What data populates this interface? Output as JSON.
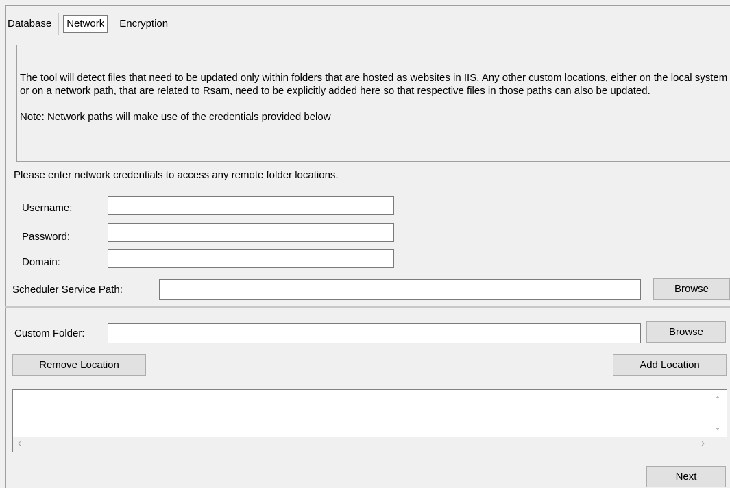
{
  "tabs": [
    {
      "label": "Database",
      "active": false
    },
    {
      "label": "Network",
      "active": true
    },
    {
      "label": "Encryption",
      "active": false
    }
  ],
  "info": {
    "text": "The tool will detect files that need to be updated only within folders that are hosted as websites in IIS. Any other custom locations, either on the local system or on a network path, that are related to Rsam, need to be explicitly added here so that respective files in those paths can also be updated.",
    "note": "Note: Network paths will make use of the credentials provided below"
  },
  "credentials": {
    "prompt": "Please enter network credentials to access any remote folder locations.",
    "username_label": "Username:",
    "username_value": "",
    "password_label": "Password:",
    "password_value": "",
    "domain_label": "Domain:",
    "domain_value": ""
  },
  "scheduler": {
    "label": "Scheduler Service Path:",
    "value": "",
    "browse_label": "Browse"
  },
  "custom_folder": {
    "label": "Custom Folder:",
    "value": "",
    "browse_label": "Browse",
    "remove_label": "Remove Location",
    "add_label": "Add Location"
  },
  "locations_list": [],
  "icons": {
    "scroll_up": "chevron-up-icon",
    "scroll_down": "chevron-down-icon",
    "scroll_left": "chevron-left-icon",
    "scroll_right": "chevron-right-icon"
  },
  "footer": {
    "next_label": "Next"
  }
}
